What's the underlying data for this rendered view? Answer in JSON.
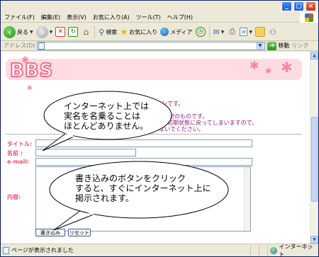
{
  "menu": [
    "ファイル(F)",
    "編集(E)",
    "表示(V)",
    "お気に入り(A)",
    "ツール(T)",
    "ヘルプ(H)"
  ],
  "toolbar": {
    "back": "戻る",
    "search": "検索",
    "favorites": "お気に入り",
    "media": "メディア"
  },
  "address": {
    "label": "アドレス(D)",
    "value": "",
    "go": "移動",
    "links": "リンク"
  },
  "page": {
    "logo": "BBS",
    "intro_lines": [
      "ションです。",
      "架空のものです。",
      "が初期状態に戻ってしまいますので、",
      "ないでください。"
    ],
    "form": {
      "title_label": "タイトル:",
      "name_label": "名前 :",
      "email_label": "e-mail:",
      "content_label": "内容:",
      "submit": "書き込み",
      "reset": "リセット"
    }
  },
  "balloons": {
    "top": [
      "インターネット上では",
      "実名を名乗ることは",
      "ほとんどありません。"
    ],
    "bottom": [
      "書き込みのボタンをクリック",
      "すると、すぐにインターネット上に",
      "掲示されます。"
    ]
  },
  "status": {
    "message": "ページが表示されました",
    "zone": "インターネット"
  }
}
